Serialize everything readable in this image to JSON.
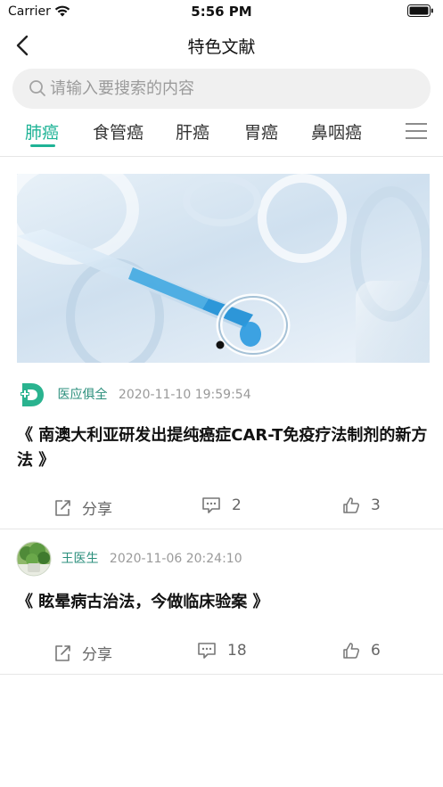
{
  "status_bar": {
    "carrier": "Carrier",
    "time": "5:56 PM"
  },
  "nav": {
    "title": "特色文献"
  },
  "search": {
    "placeholder": "请输入要搜索的内容",
    "value": ""
  },
  "tabs": [
    {
      "label": "肺癌",
      "active": true
    },
    {
      "label": "食管癌",
      "active": false
    },
    {
      "label": "肝癌",
      "active": false
    },
    {
      "label": "胃癌",
      "active": false
    },
    {
      "label": "鼻咽癌",
      "active": false
    }
  ],
  "colors": {
    "accent": "#1fb396",
    "author_name": "#2b8f7c",
    "secondary_text": "#9a9a9a"
  },
  "articles": [
    {
      "author": "医应俱全",
      "timestamp": "2020-11-10 19:59:54",
      "title": "《 南澳大利亚研发出提纯癌症CAR-T免疫疗法制剂的新方法 》",
      "share_label": "分享",
      "comments": "2",
      "likes": "3",
      "has_image": true
    },
    {
      "author": "王医生",
      "timestamp": "2020-11-06 20:24:10",
      "title": "《 眩晕病古治法，今做临床验案 》",
      "share_label": "分享",
      "comments": "18",
      "likes": "6",
      "has_image": false
    }
  ],
  "icons": [
    "wifi-icon",
    "battery-icon",
    "back-chevron-icon",
    "search-icon",
    "menu-icon",
    "share-icon",
    "comment-icon",
    "like-icon"
  ]
}
